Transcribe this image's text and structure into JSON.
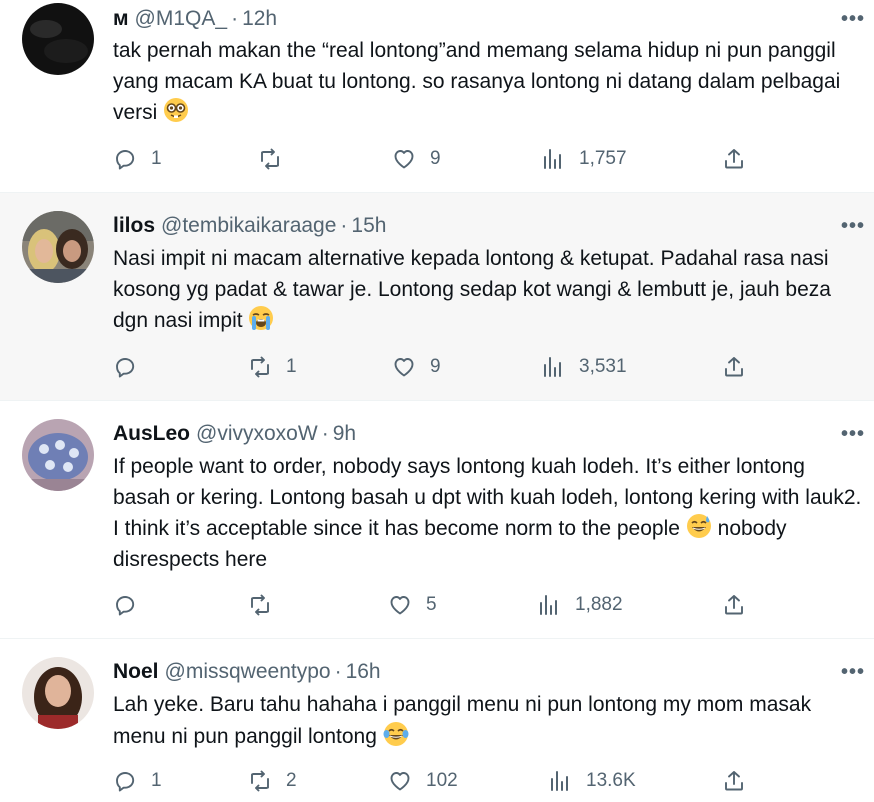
{
  "tweets": [
    {
      "display_name": "м",
      "handle": "@M1QA_",
      "separator": "·",
      "time": "12h",
      "text": "tak pernah makan the “real lontong”and memang selama hidup ni pun panggil yang macam KA buat tu lontong. so rasanya lontong ni datang dalam pelbagai versi",
      "emoji": "nerd-face",
      "replies": "1",
      "reposts": "",
      "likes": "9",
      "views": "1,757",
      "more": "•••"
    },
    {
      "display_name": "lilos",
      "handle": "@tembikaikaraage",
      "separator": "·",
      "time": "15h",
      "text": "Nasi impit ni macam alternative kepada lontong & ketupat. Padahal rasa nasi kosong yg padat & tawar je. Lontong sedap kot wangi & lembutt je, jauh beza dgn nasi impit",
      "emoji": "loudly-crying-face",
      "replies": "",
      "reposts": "1",
      "likes": "9",
      "views": "3,531",
      "more": "•••"
    },
    {
      "display_name": "AusLeo",
      "handle": "@vivyxoxoW",
      "separator": "·",
      "time": "9h",
      "text_before_emoji": "If people want to order, nobody says lontong kuah lodeh. It’s either lontong basah or kering. Lontong basah u dpt with kuah lodeh, lontong kering with lauk2. I think it’s acceptable since it has become norm to the people",
      "text_after_emoji": " nobody disrespects here",
      "emoji": "grinning-face-with-sweat",
      "replies": "",
      "reposts": "",
      "likes": "5",
      "views": "1,882",
      "more": "•••"
    },
    {
      "display_name": "Noel",
      "handle": "@missqweentypo",
      "separator": "·",
      "time": "16h",
      "text": "Lah yeke. Baru tahu hahaha i panggil menu ni pun lontong my mom masak menu ni pun panggil lontong",
      "emoji": "face-with-tears-of-joy",
      "replies": "1",
      "reposts": "2",
      "likes": "102",
      "views": "13.6K",
      "more": "•••"
    }
  ],
  "colors": {
    "text": "#0f1419",
    "secondary": "#536471",
    "highlight_bg": "#f7f7f7",
    "divider": "#eff3f4"
  }
}
